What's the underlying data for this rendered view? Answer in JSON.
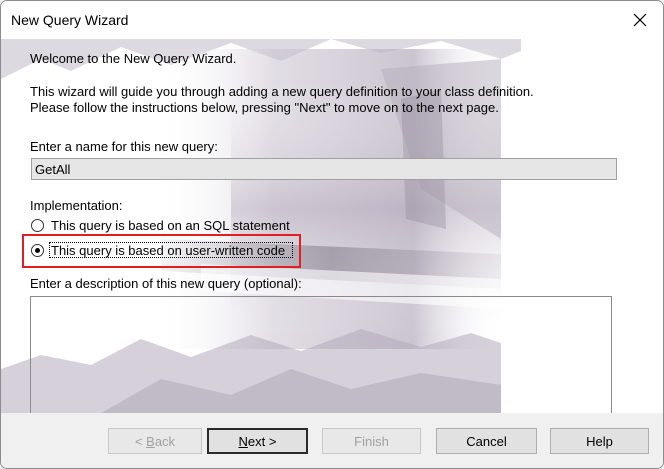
{
  "window": {
    "title": "New Query Wizard"
  },
  "intro": {
    "welcome": "Welcome to the New Query Wizard.",
    "line1": "This wizard will guide you through adding a new query definition to your class definition.",
    "line2": "Please follow the instructions below, pressing \"Next\" to move on to the next page."
  },
  "name_field": {
    "label": "Enter a name for this new query:",
    "value": "GetAll"
  },
  "implementation": {
    "label": "Implementation:",
    "options": [
      {
        "label": "This query is based on an SQL statement",
        "selected": false
      },
      {
        "label": "This query is based on user-written code",
        "selected": true
      }
    ]
  },
  "description_field": {
    "label": "Enter a description of this new query (optional):",
    "value": ""
  },
  "buttons": {
    "back": {
      "accel": "B",
      "rest": "ack",
      "prefix": "< ",
      "enabled": false
    },
    "next": {
      "accel": "N",
      "rest": "ext >",
      "enabled": true
    },
    "finish": {
      "label": "Finish",
      "enabled": false
    },
    "cancel": {
      "label": "Cancel",
      "enabled": true
    },
    "help": {
      "label": "Help",
      "enabled": true
    }
  },
  "colors": {
    "highlight": "#e02020",
    "watermark": "#a89bb0"
  },
  "icons": {
    "close": "close-icon",
    "radio_unchecked": "radio-unchecked-icon",
    "radio_checked": "radio-checked-icon"
  }
}
